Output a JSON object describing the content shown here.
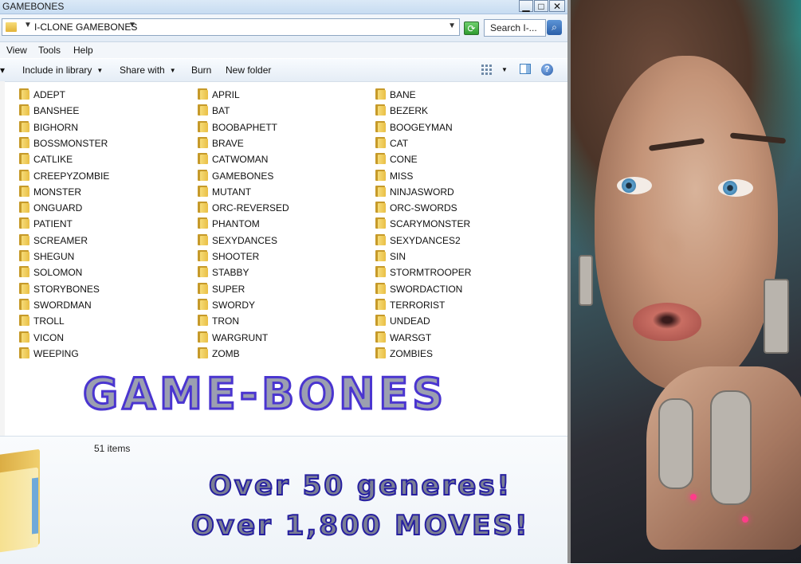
{
  "window": {
    "title": "GAMEBONES",
    "minimize_glyph": "▁",
    "maximize_glyph": "□",
    "close_glyph": "✕"
  },
  "address": {
    "path": "I-CLONE GAMEBONES",
    "search_placeholder": "Search I-..."
  },
  "menu": [
    "View",
    "Tools",
    "Help"
  ],
  "toolbar": {
    "include": "Include in library",
    "share": "Share with",
    "burn": "Burn",
    "new_folder": "New folder"
  },
  "folders": {
    "col1": [
      "ADEPT",
      "BANSHEE",
      "BIGHORN",
      "BOSSMONSTER",
      "CATLIKE",
      "CREEPYZOMBIE",
      "MONSTER",
      "ONGUARD",
      "PATIENT",
      "SCREAMER",
      "SHEGUN",
      "SOLOMON",
      "STORYBONES",
      "SWORDMAN",
      "TROLL",
      "VICON",
      "WEEPING"
    ],
    "col2": [
      "APRIL",
      "BAT",
      "BOOBAPHETT",
      "BRAVE",
      "CATWOMAN",
      "GAMEBONES",
      "MUTANT",
      "ORC-REVERSED",
      "PHANTOM",
      "SEXYDANCES",
      "SHOOTER",
      "STABBY",
      "SUPER",
      "SWORDY",
      "TRON",
      "WARGRUNT",
      "ZOMB"
    ],
    "col3": [
      "BANE",
      "BEZERK",
      "BOOGEYMAN",
      "CAT",
      "CONE",
      "MISS",
      "NINJASWORD",
      "ORC-SWORDS",
      "SCARYMONSTER",
      "SEXYDANCES2",
      "SIN",
      "STORMTROOPER",
      "SWORDACTION",
      "TERRORIST",
      "UNDEAD",
      "WARSGT",
      "ZOMBIES"
    ]
  },
  "status": {
    "count": "51 items"
  },
  "promo": {
    "brand": "GAME-BONES",
    "line1": "Over 50 generes!",
    "line2": "Over 1,800 MOVES!"
  },
  "colors": {
    "promo_outline": "#261fa0",
    "promo_fill": "#7b7f94",
    "brand_outline": "#4a35d0"
  }
}
